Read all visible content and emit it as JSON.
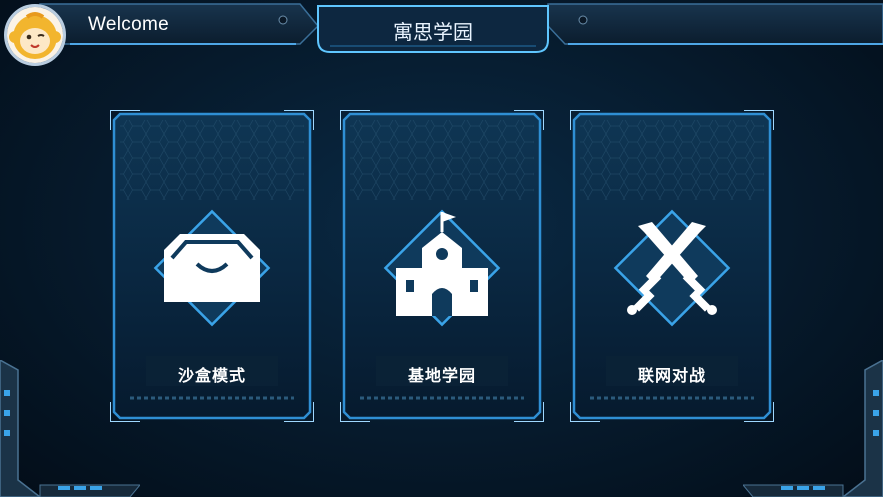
{
  "header": {
    "welcome": "Welcome",
    "title": "寓思学园",
    "avatar_icon": "monkey-avatar-icon"
  },
  "modes": [
    {
      "label": "沙盒模式",
      "icon": "sandbox-box-icon"
    },
    {
      "label": "基地学园",
      "icon": "school-building-icon"
    },
    {
      "label": "联网对战",
      "icon": "crossed-swords-icon"
    }
  ],
  "colors": {
    "background": "#061a2c",
    "frame": "#2f8fd4",
    "glow": "#5fc6ff",
    "accent": "#1a8fff"
  }
}
